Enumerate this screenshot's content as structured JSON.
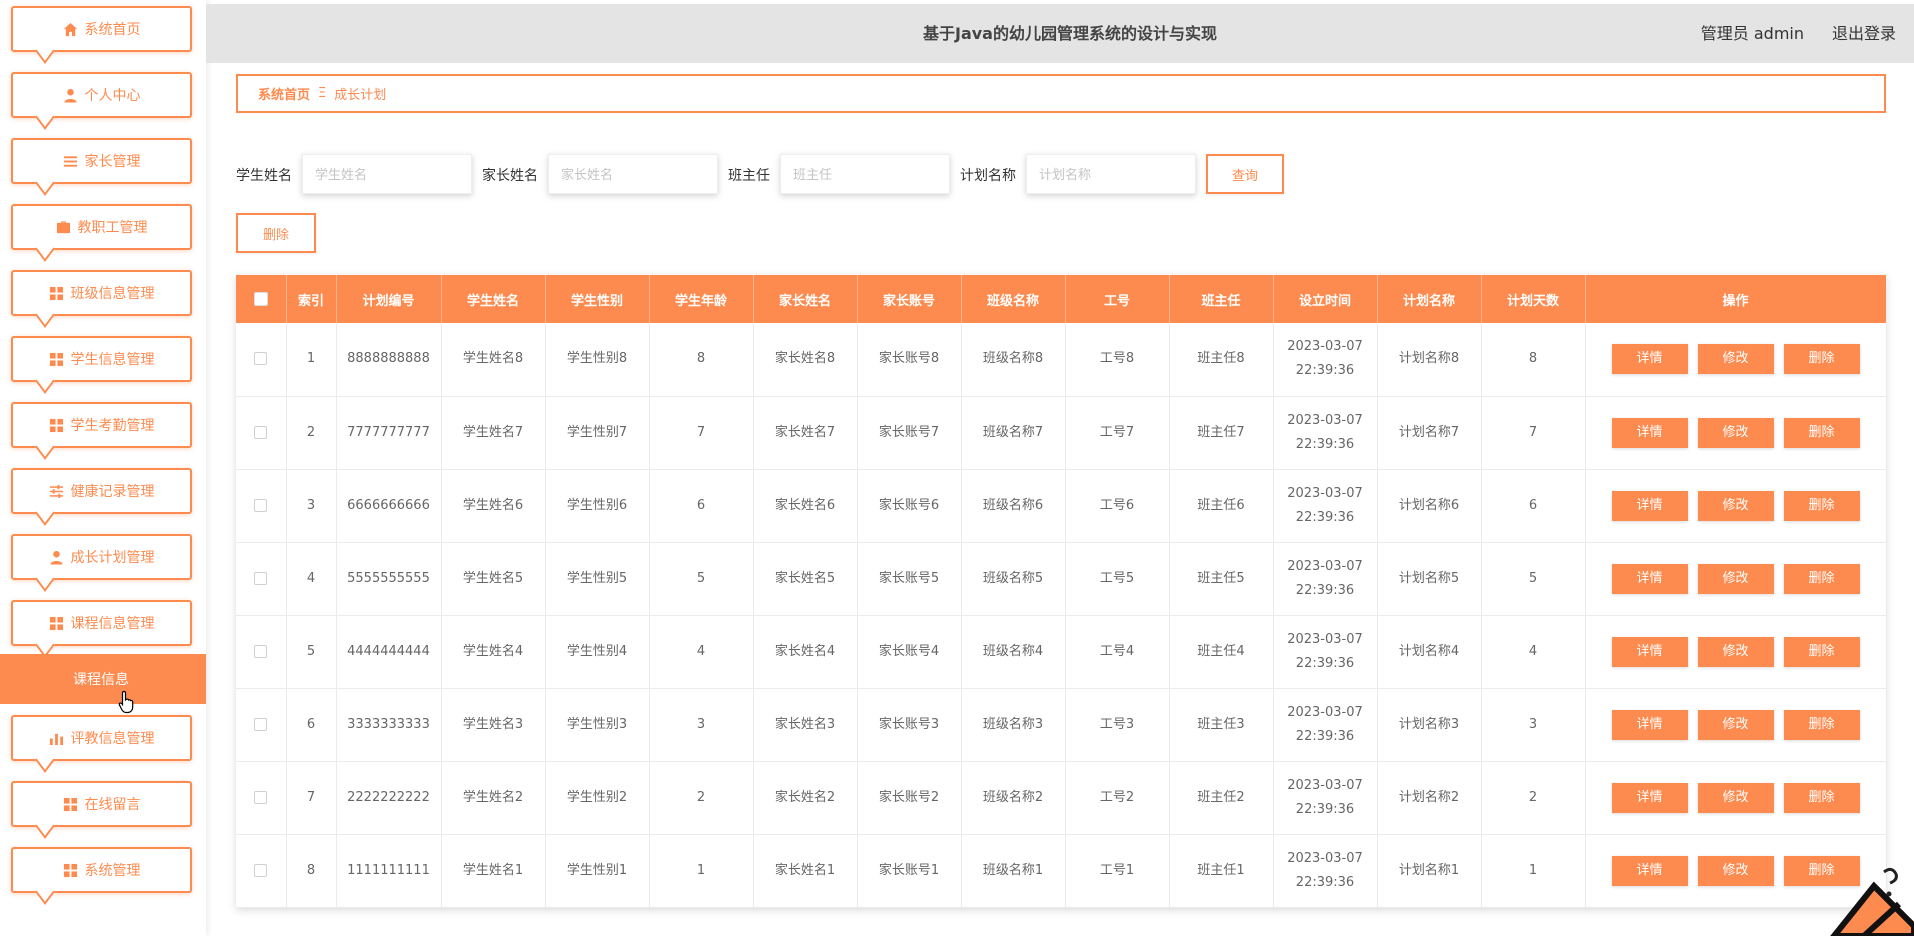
{
  "app": {
    "title": "基于Java的幼儿园管理系统的设计与实现",
    "user": "管理员 admin",
    "logout": "退出登录"
  },
  "colors": {
    "accent": "#fd8b4f",
    "header_bg": "#e4e4e4"
  },
  "sidebar": {
    "items": [
      {
        "label": "系统首页",
        "icon": "home-icon"
      },
      {
        "label": "个人中心",
        "icon": "user-icon"
      },
      {
        "label": "家长管理",
        "icon": "list-icon"
      },
      {
        "label": "教职工管理",
        "icon": "briefcase-icon"
      },
      {
        "label": "班级信息管理",
        "icon": "grid-icon"
      },
      {
        "label": "学生信息管理",
        "icon": "grid-icon"
      },
      {
        "label": "学生考勤管理",
        "icon": "grid-icon"
      },
      {
        "label": "健康记录管理",
        "icon": "sliders-icon"
      },
      {
        "label": "成长计划管理",
        "icon": "user-icon"
      },
      {
        "label": "课程信息管理",
        "icon": "grid-icon"
      },
      {
        "label": "评教信息管理",
        "icon": "bar-chart-icon"
      },
      {
        "label": "在线留言",
        "icon": "grid-icon"
      },
      {
        "label": "系统管理",
        "icon": "grid-icon"
      }
    ],
    "active_sub": "课程信息"
  },
  "breadcrumb": {
    "home": "系统首页",
    "separator": "Ξ",
    "current": "成长计划"
  },
  "search": {
    "fields": [
      {
        "label": "学生姓名",
        "placeholder": "学生姓名"
      },
      {
        "label": "家长姓名",
        "placeholder": "家长姓名"
      },
      {
        "label": "班主任",
        "placeholder": "班主任"
      },
      {
        "label": "计划名称",
        "placeholder": "计划名称"
      }
    ],
    "query_button": "查询",
    "delete_button": "删除"
  },
  "table": {
    "headers": [
      "索引",
      "计划编号",
      "学生姓名",
      "学生性别",
      "学生年龄",
      "家长姓名",
      "家长账号",
      "班级名称",
      "工号",
      "班主任",
      "设立时间",
      "计划名称",
      "计划天数",
      "操作"
    ],
    "actions": {
      "detail": "详情",
      "edit": "修改",
      "delete": "删除"
    },
    "rows": [
      {
        "index": "1",
        "plan_no": "8888888888",
        "student_name": "学生姓名8",
        "student_gender": "学生性别8",
        "student_age": "8",
        "parent_name": "家长姓名8",
        "parent_account": "家长账号8",
        "class_name": "班级名称8",
        "staff_no": "工号8",
        "head_teacher": "班主任8",
        "date": "2023-03-07",
        "time": "22:39:36",
        "plan_name": "计划名称8",
        "plan_days": "8"
      },
      {
        "index": "2",
        "plan_no": "7777777777",
        "student_name": "学生姓名7",
        "student_gender": "学生性别7",
        "student_age": "7",
        "parent_name": "家长姓名7",
        "parent_account": "家长账号7",
        "class_name": "班级名称7",
        "staff_no": "工号7",
        "head_teacher": "班主任7",
        "date": "2023-03-07",
        "time": "22:39:36",
        "plan_name": "计划名称7",
        "plan_days": "7"
      },
      {
        "index": "3",
        "plan_no": "6666666666",
        "student_name": "学生姓名6",
        "student_gender": "学生性别6",
        "student_age": "6",
        "parent_name": "家长姓名6",
        "parent_account": "家长账号6",
        "class_name": "班级名称6",
        "staff_no": "工号6",
        "head_teacher": "班主任6",
        "date": "2023-03-07",
        "time": "22:39:36",
        "plan_name": "计划名称6",
        "plan_days": "6"
      },
      {
        "index": "4",
        "plan_no": "5555555555",
        "student_name": "学生姓名5",
        "student_gender": "学生性别5",
        "student_age": "5",
        "parent_name": "家长姓名5",
        "parent_account": "家长账号5",
        "class_name": "班级名称5",
        "staff_no": "工号5",
        "head_teacher": "班主任5",
        "date": "2023-03-07",
        "time": "22:39:36",
        "plan_name": "计划名称5",
        "plan_days": "5"
      },
      {
        "index": "5",
        "plan_no": "4444444444",
        "student_name": "学生姓名4",
        "student_gender": "学生性别4",
        "student_age": "4",
        "parent_name": "家长姓名4",
        "parent_account": "家长账号4",
        "class_name": "班级名称4",
        "staff_no": "工号4",
        "head_teacher": "班主任4",
        "date": "2023-03-07",
        "time": "22:39:36",
        "plan_name": "计划名称4",
        "plan_days": "4"
      },
      {
        "index": "6",
        "plan_no": "3333333333",
        "student_name": "学生姓名3",
        "student_gender": "学生性别3",
        "student_age": "3",
        "parent_name": "家长姓名3",
        "parent_account": "家长账号3",
        "class_name": "班级名称3",
        "staff_no": "工号3",
        "head_teacher": "班主任3",
        "date": "2023-03-07",
        "time": "22:39:36",
        "plan_name": "计划名称3",
        "plan_days": "3"
      },
      {
        "index": "7",
        "plan_no": "2222222222",
        "student_name": "学生姓名2",
        "student_gender": "学生性别2",
        "student_age": "2",
        "parent_name": "家长姓名2",
        "parent_account": "家长账号2",
        "class_name": "班级名称2",
        "staff_no": "工号2",
        "head_teacher": "班主任2",
        "date": "2023-03-07",
        "time": "22:39:36",
        "plan_name": "计划名称2",
        "plan_days": "2"
      },
      {
        "index": "8",
        "plan_no": "1111111111",
        "student_name": "学生姓名1",
        "student_gender": "学生性别1",
        "student_age": "1",
        "parent_name": "家长姓名1",
        "parent_account": "家长账号1",
        "class_name": "班级名称1",
        "staff_no": "工号1",
        "head_teacher": "班主任1",
        "date": "2023-03-07",
        "time": "22:39:36",
        "plan_name": "计划名称1",
        "plan_days": "1"
      }
    ]
  }
}
